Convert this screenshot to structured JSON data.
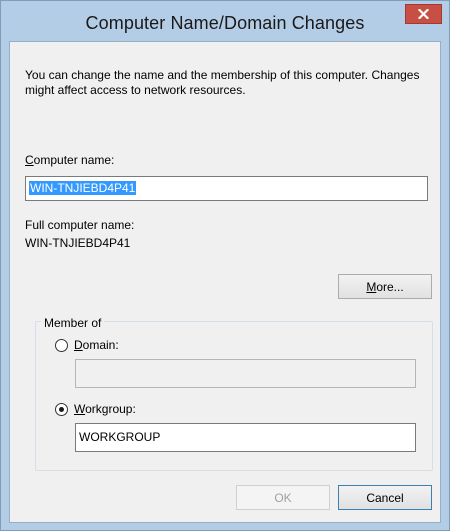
{
  "window": {
    "title": "Computer Name/Domain Changes",
    "close_glyph": "x"
  },
  "description": "You can change the name and the membership of this computer. Changes might affect access to network resources.",
  "computer_name": {
    "label_mnemonic": "C",
    "label_rest": "omputer name:",
    "value": "WIN-TNJIEBD4P41"
  },
  "full_computer_name": {
    "label": "Full computer name:",
    "value": "WIN-TNJIEBD4P41"
  },
  "more_button": {
    "mnemonic": "M",
    "rest": "ore..."
  },
  "member_of": {
    "title": "Member of",
    "domain": {
      "mnemonic": "D",
      "rest": "omain:",
      "value": "",
      "selected": false
    },
    "workgroup": {
      "mnemonic": "W",
      "rest": "orkgroup:",
      "value": "WORKGROUP",
      "selected": true
    }
  },
  "buttons": {
    "ok": "OK",
    "cancel": "Cancel"
  },
  "colors": {
    "frame": "#b4cde6",
    "client": "#f0f0f0",
    "close_button": "#c74f44",
    "selection": "#3399ff"
  },
  "icons": {
    "close": "close-icon",
    "radio_unchecked": "radio-unchecked",
    "radio_checked": "radio-checked"
  }
}
